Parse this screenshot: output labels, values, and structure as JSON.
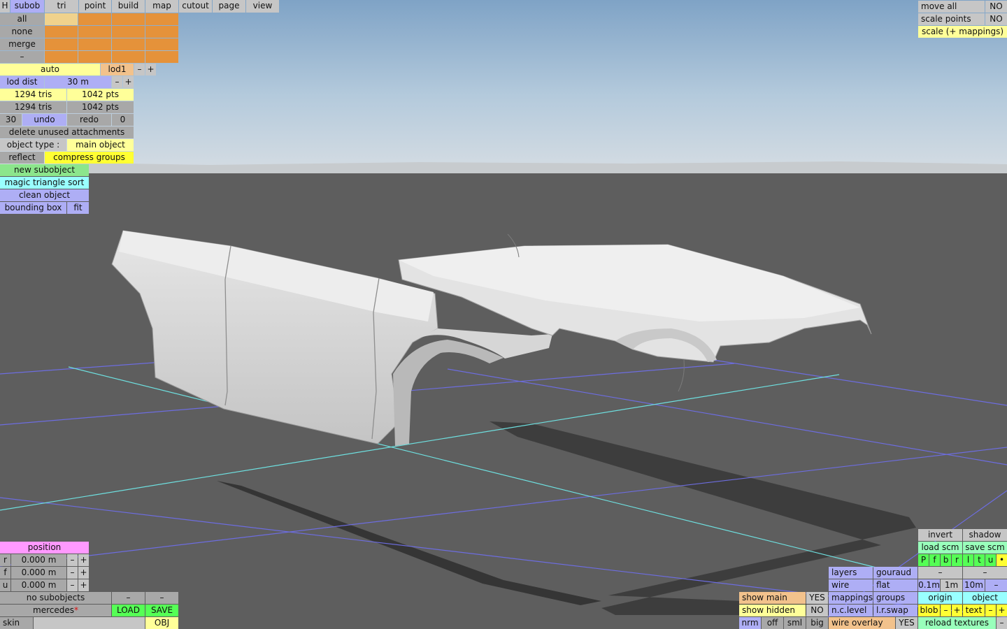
{
  "menu": {
    "h": "H",
    "tabs": [
      "subob",
      "tri",
      "point",
      "build",
      "map",
      "cutout",
      "page",
      "view"
    ]
  },
  "select": {
    "all": "all",
    "none": "none",
    "merge": "merge",
    "dash": "–"
  },
  "lod": {
    "auto": "auto",
    "name": "lod1",
    "minus": "–",
    "plus": "+",
    "dist_label": "lod dist",
    "dist_value": "30 m"
  },
  "stats": {
    "tris1": "1294 tris",
    "pts1": "1042 pts",
    "tris2": "1294 tris",
    "pts2": "1042 pts"
  },
  "history": {
    "count": "30",
    "undo": "undo",
    "redo": "redo",
    "redo_count": "0"
  },
  "actions": {
    "delete_unused": "delete unused attachments",
    "object_type_label": "object type :",
    "object_type_value": "main object",
    "reflect": "reflect",
    "compress_groups": "compress groups",
    "new_subobject": "new subobject",
    "magic_sort": "magic triangle sort",
    "clean_object": "clean object",
    "bounding_box": "bounding box",
    "fit": "fit"
  },
  "top_right": {
    "move_all": "move all",
    "move_all_value": "NO",
    "scale_points": "scale points",
    "scale_points_value": "NO",
    "scale_mappings": "scale (+ mappings)"
  },
  "position": {
    "title": "position",
    "rows": [
      {
        "axis": "r",
        "value": "0.000 m"
      },
      {
        "axis": "f",
        "value": "0.000 m"
      },
      {
        "axis": "u",
        "value": "0.000 m"
      }
    ],
    "minus": "–",
    "plus": "+"
  },
  "file": {
    "no_subobjects": "no subobjects",
    "dash": "–",
    "name": "mercedes",
    "modified_mark": "*",
    "load": "LOAD",
    "save": "SAVE",
    "skin": "skin",
    "obj": "OBJ"
  },
  "view_opts": {
    "show_main": "show main",
    "show_main_value": "YES",
    "show_hidden": "show hidden",
    "show_hidden_value": "NO",
    "nrm": "nrm",
    "off": "off",
    "sml": "sml",
    "big": "big"
  },
  "render": {
    "layers": "layers",
    "gouraud": "gouraud",
    "wire": "wire",
    "flat": "flat",
    "mappings": "mappings",
    "groups": "groups",
    "nc_level": "n.c.level",
    "lr_swap": "l.r.swap",
    "wire_overlay": "wire overlay",
    "wire_overlay_value": "YES"
  },
  "br": {
    "invert": "invert",
    "shadow": "shadow",
    "load_scm": "load scm",
    "save_scm": "save scm",
    "letters": [
      "P",
      "f",
      "b",
      "r",
      "l",
      "t",
      "u",
      "•"
    ],
    "dash": "–",
    "grid": [
      "0.1m",
      "1m",
      "10m"
    ],
    "origin": "origin",
    "object": "object",
    "blob": "blob",
    "text": "text",
    "reload": "reload textures",
    "minus": "–",
    "plus": "+"
  }
}
